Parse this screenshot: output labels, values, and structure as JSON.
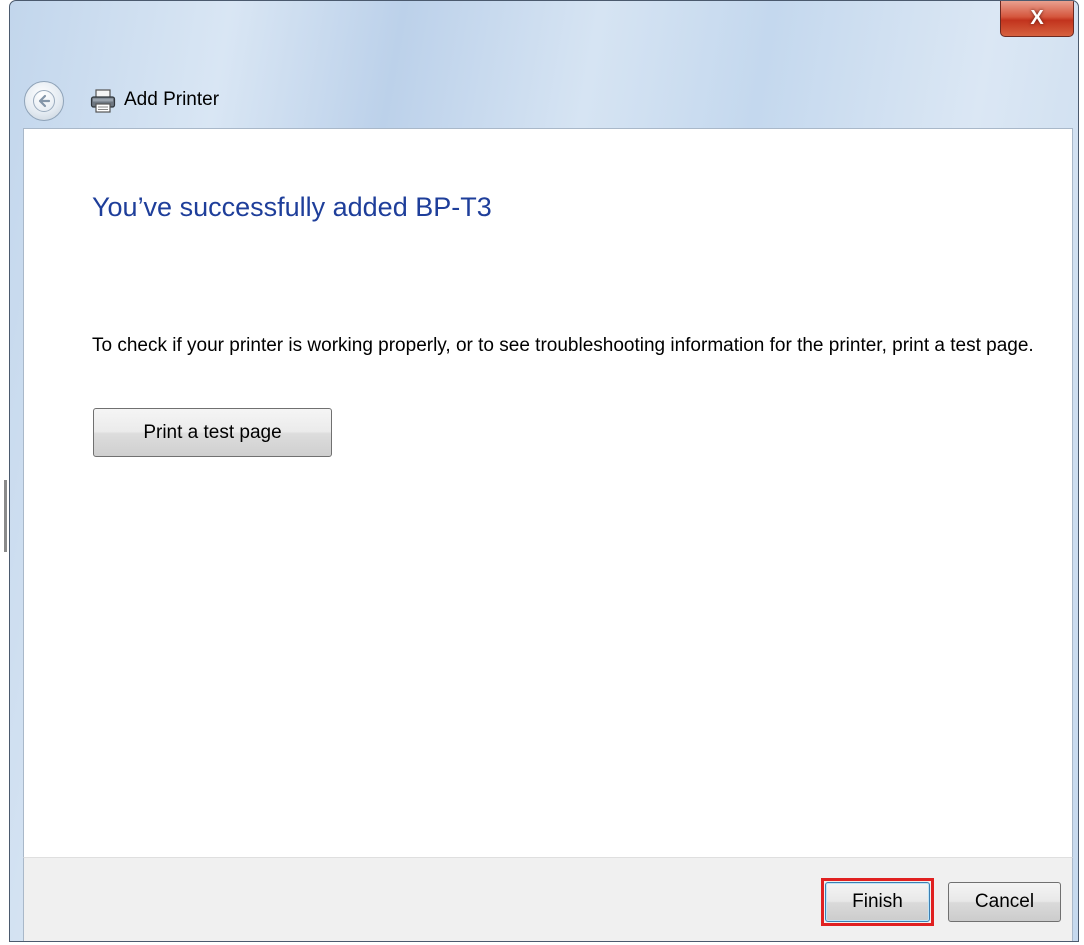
{
  "window": {
    "close_label": "X"
  },
  "nav": {
    "title": "Add Printer",
    "back_icon": "back-arrow-icon",
    "title_icon": "printer-icon"
  },
  "main": {
    "heading": "You’ve successfully added BP-T3",
    "description": "To check if your printer is working properly, or to see troubleshooting information for the printer, print a test page.",
    "test_page_button": "Print a test page"
  },
  "footer": {
    "finish_label": "Finish",
    "cancel_label": "Cancel",
    "highlight_color": "#e02020"
  },
  "colors": {
    "heading": "#1e3e9a",
    "close_button": "#c2331d"
  }
}
